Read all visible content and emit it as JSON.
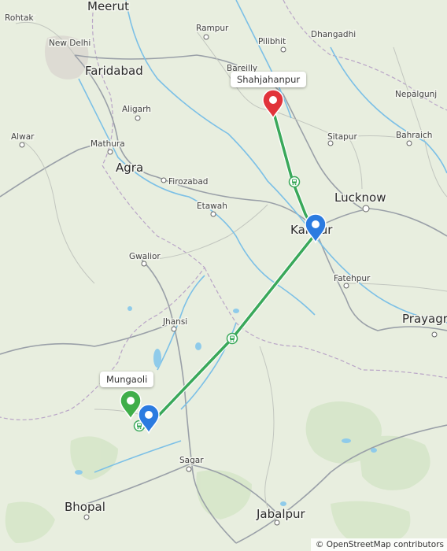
{
  "callouts": {
    "destination": "Shahjahanpur",
    "origin": "Mungaoli"
  },
  "attribution": "© OpenStreetMap contributors",
  "colors": {
    "route": "#3aa85a",
    "origin_marker": "#3fae49",
    "destination_marker": "#e1333a",
    "waypoint_marker": "#2b7be0",
    "river": "#7cc0e6",
    "land": "#e8eedf"
  },
  "icons": {
    "origin": "map-pin-icon",
    "destination": "map-pin-icon",
    "waypoint": "map-pin-icon",
    "train_stops": "train-icon"
  },
  "places": [
    {
      "name": "Meerut",
      "size": "big"
    },
    {
      "name": "Rohtak",
      "size": "small"
    },
    {
      "name": "New Delhi",
      "size": "small"
    },
    {
      "name": "Faridabad",
      "size": "big"
    },
    {
      "name": "Rampur",
      "size": "small"
    },
    {
      "name": "Pilibhit",
      "size": "small"
    },
    {
      "name": "Dhangadhi",
      "size": "small"
    },
    {
      "name": "Bareilly",
      "size": "small"
    },
    {
      "name": "Aligarh",
      "size": "small"
    },
    {
      "name": "Nepalgunj",
      "size": "small"
    },
    {
      "name": "Alwar",
      "size": "small"
    },
    {
      "name": "Mathura",
      "size": "small"
    },
    {
      "name": "Sitapur",
      "size": "small"
    },
    {
      "name": "Bahraich",
      "size": "small"
    },
    {
      "name": "Agra",
      "size": "big"
    },
    {
      "name": "Firozabad",
      "size": "small"
    },
    {
      "name": "Lucknow",
      "size": "big"
    },
    {
      "name": "Etawah",
      "size": "small"
    },
    {
      "name": "Kanpur",
      "size": "big"
    },
    {
      "name": "Gwalior",
      "size": "small"
    },
    {
      "name": "Fatehpur",
      "size": "small"
    },
    {
      "name": "Jhansi",
      "size": "small"
    },
    {
      "name": "Prayagraj",
      "size": "big"
    },
    {
      "name": "Sagar",
      "size": "small"
    },
    {
      "name": "Bhopal",
      "size": "big"
    },
    {
      "name": "Jabalpur",
      "size": "big"
    }
  ]
}
